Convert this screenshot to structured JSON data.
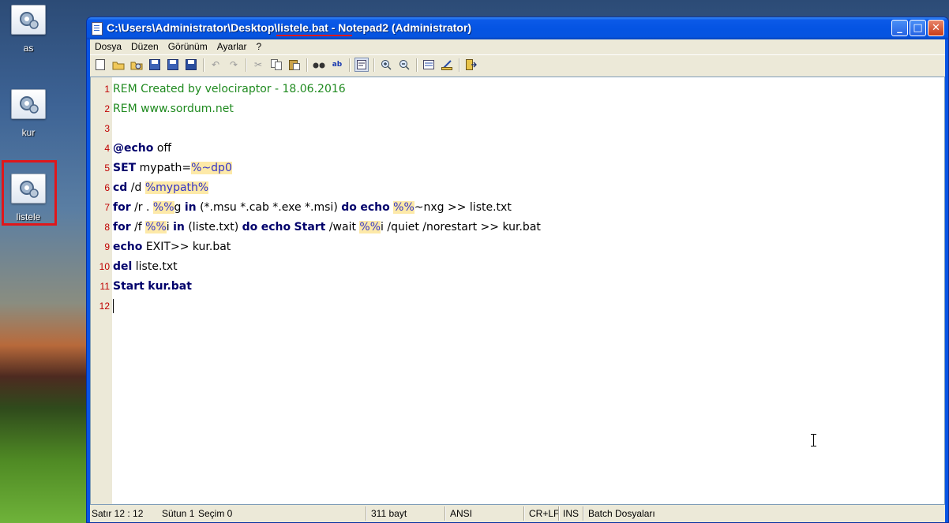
{
  "desktop": {
    "icons": [
      {
        "label": "as"
      },
      {
        "label": "kur"
      },
      {
        "label": "listele"
      }
    ]
  },
  "window": {
    "title": "C:\\Users\\Administrator\\Desktop\\listele.bat - Notepad2 (Administrator)",
    "controls": {
      "minimize": "_",
      "maximize": "□",
      "close": "✕"
    }
  },
  "menu": [
    "Dosya",
    "Düzen",
    "Görünüm",
    "Ayarlar",
    "?"
  ],
  "toolbar": [
    "new-file-icon",
    "open-file-icon",
    "browse-icon",
    "save-copy-icon",
    "save-icon",
    "save-as-icon",
    "undo-icon",
    "redo-icon",
    "cut-icon",
    "copy-icon",
    "paste-icon",
    "find-icon",
    "replace-icon",
    "word-wrap-icon",
    "zoom-in-icon",
    "zoom-out-icon",
    "scheme-icon",
    "customize-icon",
    "exit-icon"
  ],
  "editor": {
    "lines": [
      {
        "n": "1",
        "t": "REM Created by velociraptor - 18.06.2016"
      },
      {
        "n": "2",
        "t": "REM www.sordum.net"
      },
      {
        "n": "3",
        "t": ""
      },
      {
        "n": "4",
        "t": "@echo off"
      },
      {
        "n": "5",
        "t": "SET mypath=%~dp0"
      },
      {
        "n": "6",
        "t": "cd /d %mypath%"
      },
      {
        "n": "7",
        "t": "for /r . %%g in (*.msu *.cab *.exe *.msi) do echo %%~nxg >> liste.txt"
      },
      {
        "n": "8",
        "t": "for /f %%i in (liste.txt) do echo Start /wait %%i /quiet /norestart >> kur.bat"
      },
      {
        "n": "9",
        "t": "echo EXIT>> kur.bat"
      },
      {
        "n": "10",
        "t": "del liste.txt"
      },
      {
        "n": "11",
        "t": "Start kur.bat"
      },
      {
        "n": "12",
        "t": ""
      }
    ]
  },
  "status": {
    "position": "Satır 12 : 12",
    "column": "Sütun 1",
    "selection": "Seçim 0",
    "size": "311 bayt",
    "encoding": "ANSI",
    "eol": "CR+LF",
    "mode": "INS",
    "scheme": "Batch Dosyaları"
  }
}
